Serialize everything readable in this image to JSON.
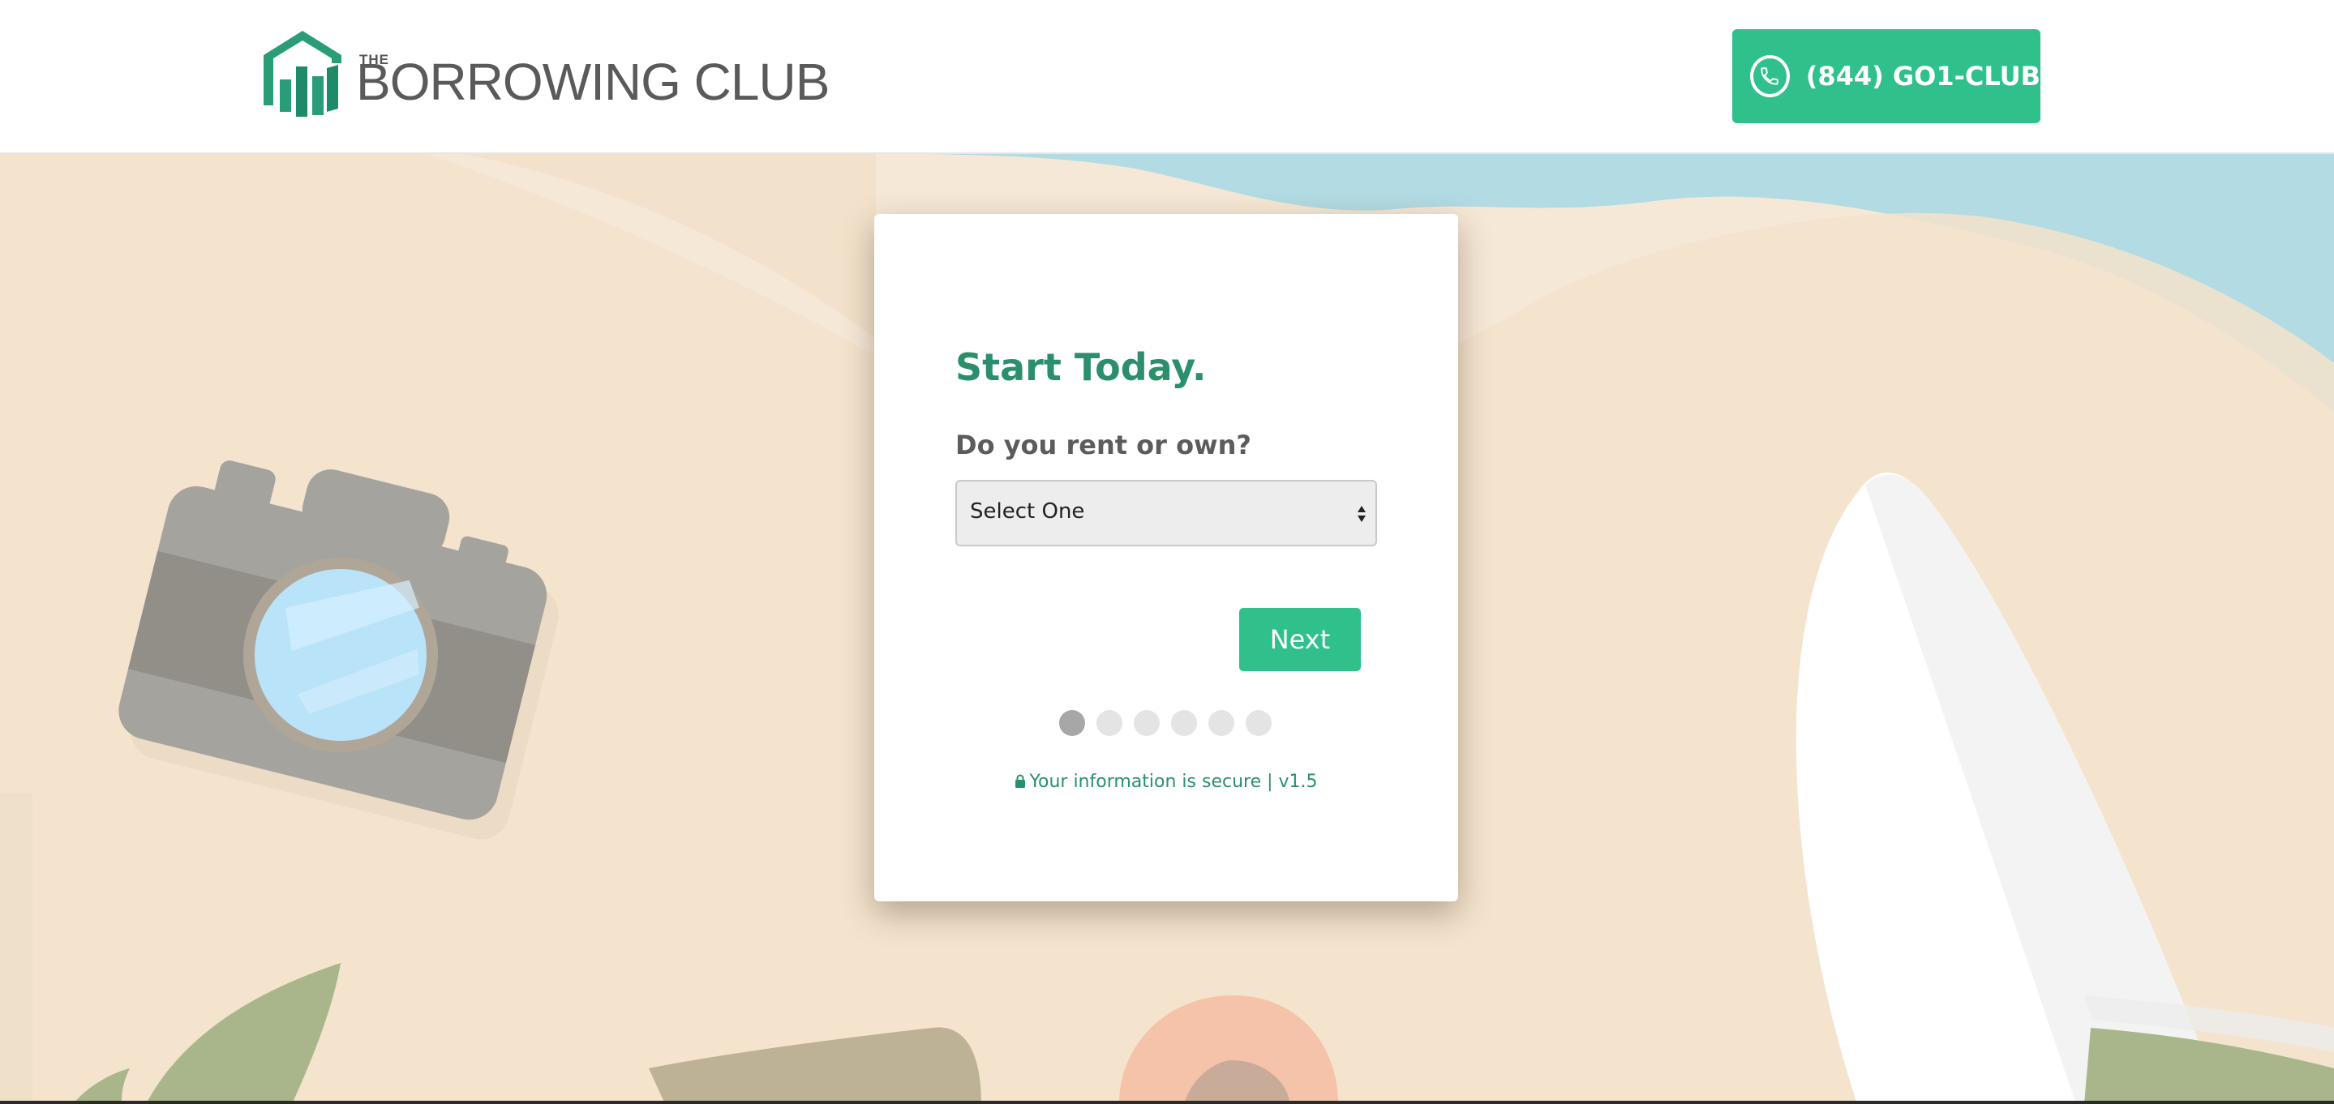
{
  "header": {
    "logo": {
      "the": "THE",
      "name": "BORROWING CLUB"
    },
    "phone_button": {
      "label": "(844) GO1-CLUB",
      "icon": "phone-icon"
    }
  },
  "form": {
    "title": "Start Today.",
    "question": "Do you rent or own?",
    "select": {
      "value": "Select One"
    },
    "next_label": "Next",
    "progress": {
      "total_steps": 6,
      "current_step": 1
    },
    "secure_text": "Your information is secure | v1.5",
    "secure_icon": "lock-icon"
  },
  "colors": {
    "accent": "#2fc08b",
    "title_green": "#2b8f6c",
    "sand": "#f6e8d6",
    "water": "#b2dbe3"
  }
}
